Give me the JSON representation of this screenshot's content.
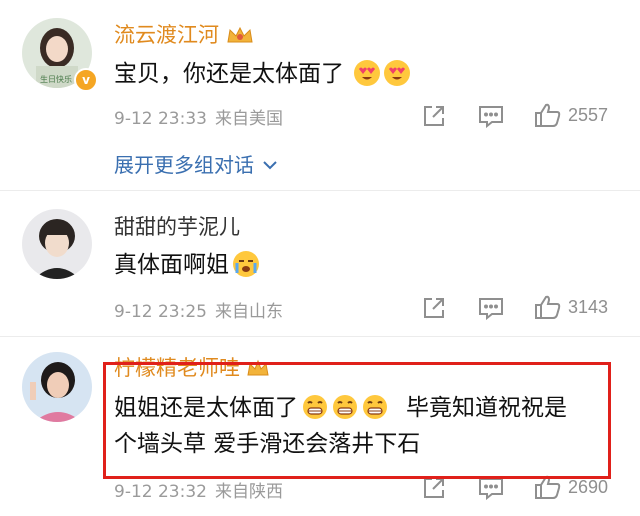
{
  "comments": [
    {
      "username": "流云渡江河",
      "text": "宝贝，你还是太体面了",
      "date": "9-12 23:33",
      "location": "来自美国",
      "likes": "2557",
      "expand_label": "展开更多组对话",
      "avatar_caption": "生日快乐"
    },
    {
      "username": "甜甜的芋泥儿",
      "text": "真体面啊姐",
      "date": "9-12 23:25",
      "location": "来自山东",
      "likes": "3143"
    },
    {
      "username": "柠檬精老师哇",
      "text_line1": "姐姐还是太体面了",
      "text_line1b": "毕竟知道祝祝是",
      "text_line2": "个墙头草 爱手滑还会落井下石",
      "date": "9-12 23:32",
      "location": "来自陕西",
      "likes": "2690"
    }
  ],
  "colors": {
    "username_vip": "#e08a1e",
    "username_normal": "#333333",
    "link": "#3a6fb0",
    "meta": "#9a9a9a",
    "highlight_box": "#e0201a"
  },
  "icons": [
    "share-icon",
    "comment-icon",
    "like-icon",
    "vip-crown-icon",
    "verified-badge-icon",
    "chevron-down-icon",
    "heart-eyes-emoji",
    "grin-emoji",
    "crying-emoji"
  ]
}
